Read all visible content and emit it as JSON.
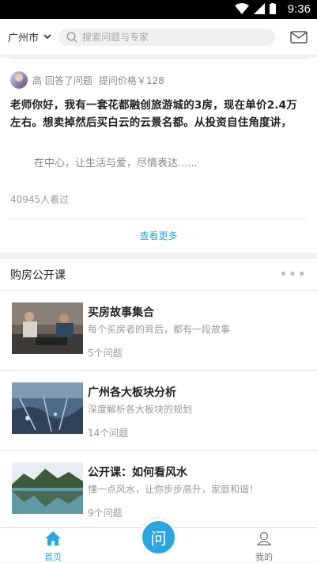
{
  "status_bar": {
    "time": "9:36"
  },
  "header": {
    "city": "广州市",
    "search_placeholder": "搜索问题与专家"
  },
  "answer_card": {
    "answerer_line": "高 回答了问题",
    "price": "提问价格￥128",
    "question": "老师你好，我有一套花都融创旅游城的3房，现在单价2.4万左右。想卖掉然后买白云的云景名都。从投资自住角度讲，",
    "excerpt": "在中心，让生活与爱，尽情表达......",
    "views": "40945人看过",
    "more": "查看更多"
  },
  "section": {
    "title": "购房公开课",
    "more_dots": "•••"
  },
  "courses": [
    {
      "title": "买房故事集合",
      "desc": "每个买房者的背后，都有一段故事",
      "count": "5个问题"
    },
    {
      "title": "广州各大板块分析",
      "desc": "深度解析各大板块的规划",
      "count": "14个问题"
    },
    {
      "title": "公开课：如何看风水",
      "desc": "懂一点风水，让你步步高升，家庭和谐！",
      "count": "9个问题"
    }
  ],
  "tabbar": {
    "home": "首页",
    "ask": "问",
    "me": "我的"
  },
  "colors": {
    "accent": "#2aa6e0"
  }
}
